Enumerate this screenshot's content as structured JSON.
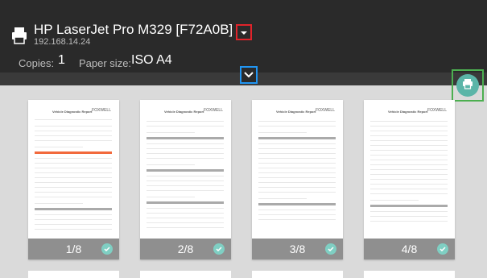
{
  "header": {
    "printer_name": "HP LaserJet Pro M329 [F72A0B]",
    "printer_ip": "192.168.14.24",
    "copies_label": "Copies:",
    "copies_value": "1",
    "paper_label": "Paper size:",
    "paper_value": "ISO A4"
  },
  "pages": [
    {
      "label": "1/8",
      "doc_title": "Vehicle Diagnostic Report",
      "logo": "FOXWELL"
    },
    {
      "label": "2/8",
      "doc_title": "Vehicle Diagnostic Report",
      "logo": "FOXWELL"
    },
    {
      "label": "3/8",
      "doc_title": "Vehicle Diagnostic Report",
      "logo": "FOXWELL"
    },
    {
      "label": "4/8",
      "doc_title": "Vehicle Diagnostic Report",
      "logo": "FOXWELL"
    }
  ],
  "colors": {
    "accent": "#5bb5a8",
    "header_bg": "#2a2a2a",
    "highlight_red": "#e0232a",
    "highlight_blue": "#2196f3",
    "highlight_green": "#4caf50"
  },
  "icons": {
    "printer": "printer-icon",
    "expand": "chevron-down-icon",
    "collapse": "chevron-down-icon",
    "print": "print-icon",
    "check": "check-icon"
  }
}
